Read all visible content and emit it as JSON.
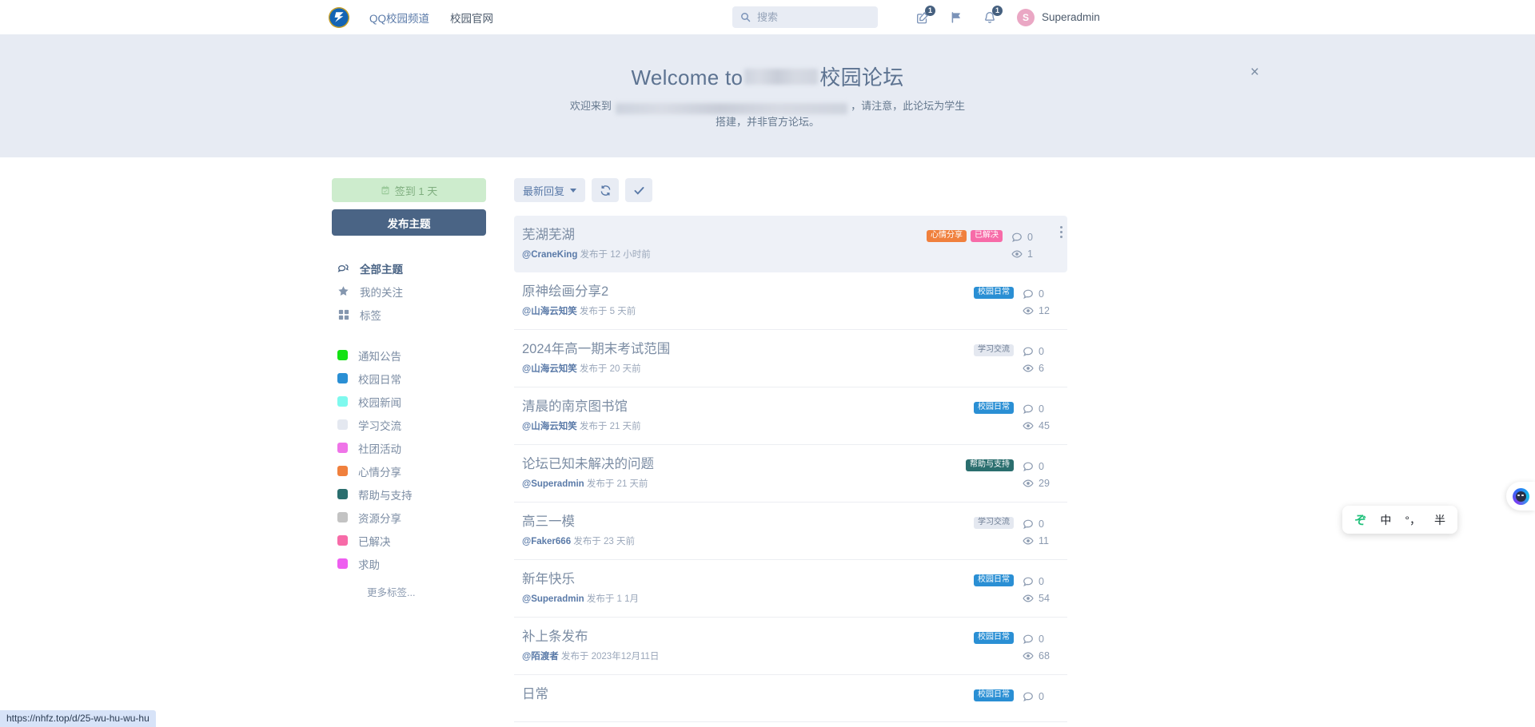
{
  "header": {
    "logo_name": "forum-logo",
    "nav": [
      {
        "label": "QQ校园频道",
        "name": "nav-qq-channel"
      },
      {
        "label": "校园官网",
        "name": "nav-school-site"
      }
    ],
    "search": {
      "placeholder": "搜索",
      "value": ""
    },
    "actions": [
      {
        "name": "compose-icon",
        "badge": "1"
      },
      {
        "name": "flag-icon",
        "badge": ""
      },
      {
        "name": "bell-icon",
        "badge": "1"
      }
    ],
    "user": {
      "initial": "S",
      "name": "Superadmin"
    }
  },
  "hero": {
    "title_prefix": "Welcome to",
    "title_suffix": "校园论坛",
    "sub_prefix": "欢迎来到",
    "sub_suffix": "，请注意，此论坛为学生搭建，并非官方论坛。",
    "close_label": "×"
  },
  "sidebar": {
    "checkin_label": "签到 1 天",
    "post_label": "发布主题",
    "nav_items": [
      {
        "label": "全部主题",
        "icon": "chat-bubbles-icon",
        "active": true
      },
      {
        "label": "我的关注",
        "icon": "star-icon",
        "active": false
      },
      {
        "label": "标签",
        "icon": "grid-icon",
        "active": false
      }
    ],
    "tags": [
      {
        "label": "通知公告",
        "color": "#14e214"
      },
      {
        "label": "校园日常",
        "color": "#2a8fd4"
      },
      {
        "label": "校园新闻",
        "color": "#7ef9ee"
      },
      {
        "label": "学习交流",
        "color": "#e4e8f0"
      },
      {
        "label": "社团活动",
        "color": "#ef74e8"
      },
      {
        "label": "心情分享",
        "color": "#f0803d"
      },
      {
        "label": "帮助与支持",
        "color": "#2a6e6e"
      },
      {
        "label": "资源分享",
        "color": "#c3c3c3"
      },
      {
        "label": "已解决",
        "color": "#f76ba8"
      },
      {
        "label": "求助",
        "color": "#ee5ef0"
      }
    ],
    "more_tags_label": "更多标签..."
  },
  "toolbar": {
    "sort_label": "最新回复",
    "refresh_name": "refresh-icon",
    "markread_name": "check-icon"
  },
  "posts": [
    {
      "title": "芜湖芜湖",
      "author": "@CraneKing",
      "meta": "发布于 12 小时前",
      "badges": [
        {
          "label": "心情分享",
          "color": "#f0803d"
        },
        {
          "label": "已解决",
          "color": "#f76ba8"
        }
      ],
      "replies": "0",
      "views": "1",
      "highlight": true
    },
    {
      "title": "原神绘画分享2",
      "author": "@山海云知笑",
      "meta": "发布于 5 天前",
      "badges": [
        {
          "label": "校园日常",
          "color": "#2a8fd4"
        }
      ],
      "replies": "0",
      "views": "12",
      "highlight": false
    },
    {
      "title": "2024年高一期末考试范围",
      "author": "@山海云知笑",
      "meta": "发布于 20 天前",
      "badges": [
        {
          "label": "学习交流",
          "color": "#e4e8f0",
          "text": "#6d7d93"
        }
      ],
      "replies": "0",
      "views": "6",
      "highlight": false
    },
    {
      "title": "清晨的南京图书馆",
      "author": "@山海云知笑",
      "meta": "发布于 21 天前",
      "badges": [
        {
          "label": "校园日常",
          "color": "#2a8fd4"
        }
      ],
      "replies": "0",
      "views": "45",
      "highlight": false
    },
    {
      "title": "论坛已知未解决的问题",
      "author": "@Superadmin",
      "meta": "发布于 21 天前",
      "badges": [
        {
          "label": "帮助与支持",
          "color": "#2a6e6e"
        }
      ],
      "replies": "0",
      "views": "29",
      "highlight": false
    },
    {
      "title": "高三一模",
      "author": "@Faker666",
      "meta": "发布于 23 天前",
      "badges": [
        {
          "label": "学习交流",
          "color": "#e4e8f0",
          "text": "#6d7d93"
        }
      ],
      "replies": "0",
      "views": "11",
      "highlight": false
    },
    {
      "title": "新年快乐",
      "author": "@Superadmin",
      "meta": "发布于 1 1月",
      "badges": [
        {
          "label": "校园日常",
          "color": "#2a8fd4"
        }
      ],
      "replies": "0",
      "views": "54",
      "highlight": false
    },
    {
      "title": "补上条发布",
      "author": "@陌渡者",
      "meta": "发布于 2023年12月11日",
      "badges": [
        {
          "label": "校园日常",
          "color": "#2a8fd4"
        }
      ],
      "replies": "0",
      "views": "68",
      "highlight": false
    },
    {
      "title": "日常",
      "author": "",
      "meta": "",
      "badges": [
        {
          "label": "校园日常",
          "color": "#2a8fd4"
        }
      ],
      "replies": "0",
      "views": "",
      "highlight": false
    }
  ],
  "statusbar": {
    "url": "https://nhfz.top/d/25-wu-hu-wu-hu"
  },
  "ime": {
    "logo": "ぞ",
    "items": [
      "中",
      "°，",
      "半"
    ]
  }
}
